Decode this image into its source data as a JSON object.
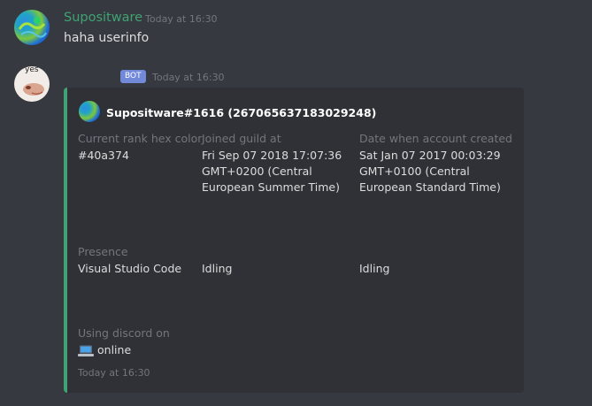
{
  "messages": [
    {
      "author": "Supositware",
      "timestamp": "Today at 16:30",
      "content": "haha userinfo"
    },
    {
      "bot_tag": "BOT",
      "timestamp": "Today at 16:30",
      "avatar_text": "yes",
      "embed": {
        "author": "Supositware#1616 (267065637183029248)",
        "fields": [
          {
            "name": "Current rank hex color",
            "value": "#40a374"
          },
          {
            "name": "Joined guild at",
            "value": "Fri Sep 07 2018 17:07:36 GMT+0200 (Central European Summer Time)"
          },
          {
            "name": "Date when account created",
            "value": "Sat Jan 07 2017 00:03:29 GMT+0100 (Central European Standard Time)"
          },
          {
            "name": "Presence",
            "value": "Visual Studio Code"
          },
          {
            "name": "",
            "value": "Idling"
          },
          {
            "name": "",
            "value": "Idling"
          },
          {
            "name": "Using discord on",
            "value": "online"
          }
        ],
        "footer": "Today at 16:30"
      }
    }
  ],
  "colors": {
    "accent": "#40a374",
    "background": "#36393f",
    "embed": "#2f3136",
    "bot_badge": "#7289da"
  },
  "icons": {
    "device": "laptop-icon"
  }
}
